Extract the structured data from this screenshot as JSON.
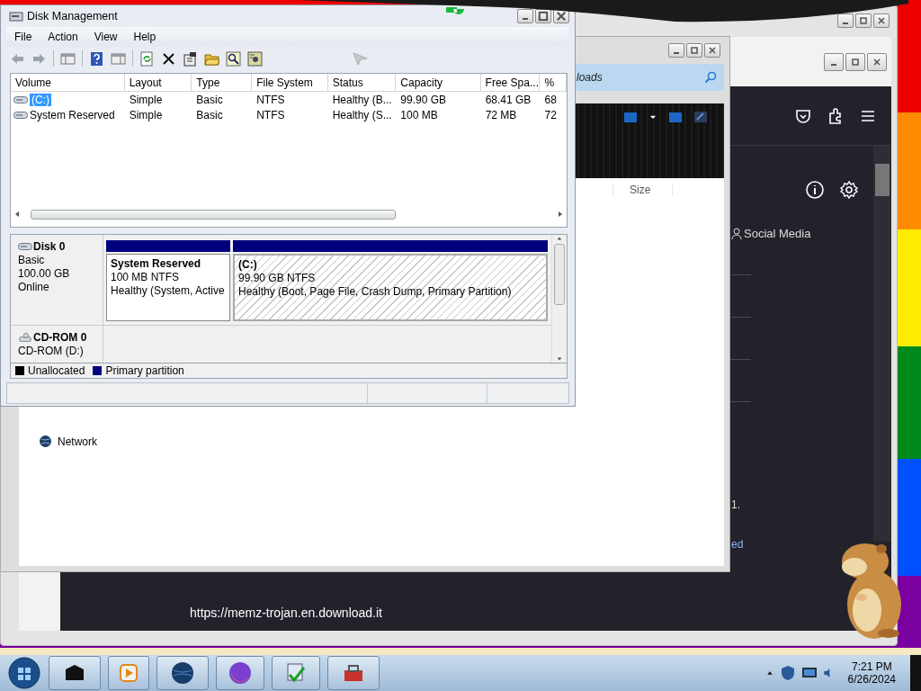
{
  "browser": {
    "tabs": [
      {
        "label": "Social Media"
      }
    ],
    "texts": [
      "1."
    ],
    "link": "ed",
    "url": "https://memz-trojan.en.download.it"
  },
  "explorer": {
    "address": "loads",
    "columns": [
      "Size"
    ],
    "nav_items": [
      "Network"
    ]
  },
  "disk_management": {
    "title": "Disk Management",
    "menu": [
      "File",
      "Action",
      "View",
      "Help"
    ],
    "columns": [
      "Volume",
      "Layout",
      "Type",
      "File System",
      "Status",
      "Capacity",
      "Free Spa...",
      "%"
    ],
    "volumes": [
      {
        "cells": [
          "(C:)",
          "Simple",
          "Basic",
          "NTFS",
          "Healthy (B...",
          "99.90 GB",
          "68.41 GB",
          "68"
        ],
        "selected": true
      },
      {
        "cells": [
          "System Reserved",
          "Simple",
          "Basic",
          "NTFS",
          "Healthy (S...",
          "100 MB",
          "72 MB",
          "72"
        ],
        "selected": false
      }
    ],
    "disks": [
      {
        "kind": "disk",
        "name": "Disk 0",
        "details": [
          "Basic",
          "100.00 GB",
          "Online"
        ],
        "partitions": [
          {
            "name": "System Reserved",
            "size": "100 MB NTFS",
            "status": "Healthy (System, Active",
            "selected": false
          },
          {
            "name": "(C:)",
            "size": "99.90 GB NTFS",
            "status": "Healthy (Boot, Page File, Crash Dump, Primary Partition)",
            "selected": true
          }
        ]
      },
      {
        "kind": "cdrom",
        "name": "CD-ROM 0",
        "details": [
          "CD-ROM (D:)"
        ]
      }
    ],
    "legend": [
      {
        "label": "Unallocated",
        "color": "#000000"
      },
      {
        "label": "Primary partition",
        "color": "#00007f"
      }
    ]
  },
  "taskbar": {
    "time": "7:21 PM",
    "date": "6/26/2024"
  }
}
